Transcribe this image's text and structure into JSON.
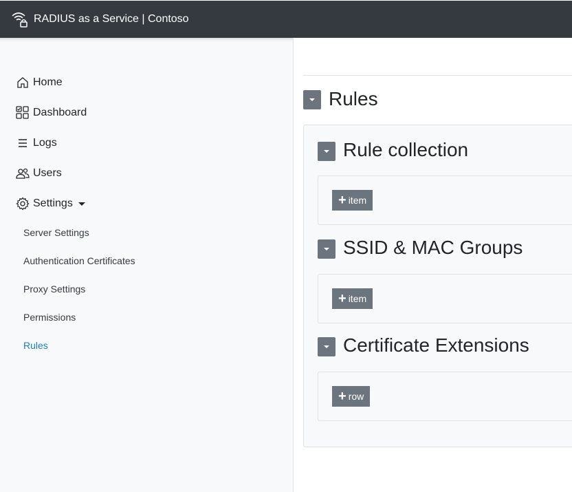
{
  "app": {
    "title": "RADIUS as a Service | Contoso"
  },
  "sidebar": {
    "items": [
      {
        "label": "Home",
        "icon": "home-icon"
      },
      {
        "label": "Dashboard",
        "icon": "dashboard-icon"
      },
      {
        "label": "Logs",
        "icon": "list-icon"
      },
      {
        "label": "Users",
        "icon": "users-icon"
      },
      {
        "label": "Settings",
        "icon": "gear-icon"
      }
    ],
    "settings_children": [
      {
        "label": "Server Settings"
      },
      {
        "label": "Authentication Certificates"
      },
      {
        "label": "Proxy Settings"
      },
      {
        "label": "Permissions"
      },
      {
        "label": "Rules",
        "active": true
      }
    ]
  },
  "main": {
    "title": "Rules",
    "sections": [
      {
        "title": "Rule collection",
        "button": "item"
      },
      {
        "title": "SSID & MAC Groups",
        "button": "item"
      },
      {
        "title": "Certificate Extensions",
        "button": "row"
      }
    ]
  },
  "colors": {
    "topbar": "#343a40",
    "sidebar": "#f8f9fa",
    "button": "#6c757d",
    "active_link": "#1f7ac4"
  }
}
